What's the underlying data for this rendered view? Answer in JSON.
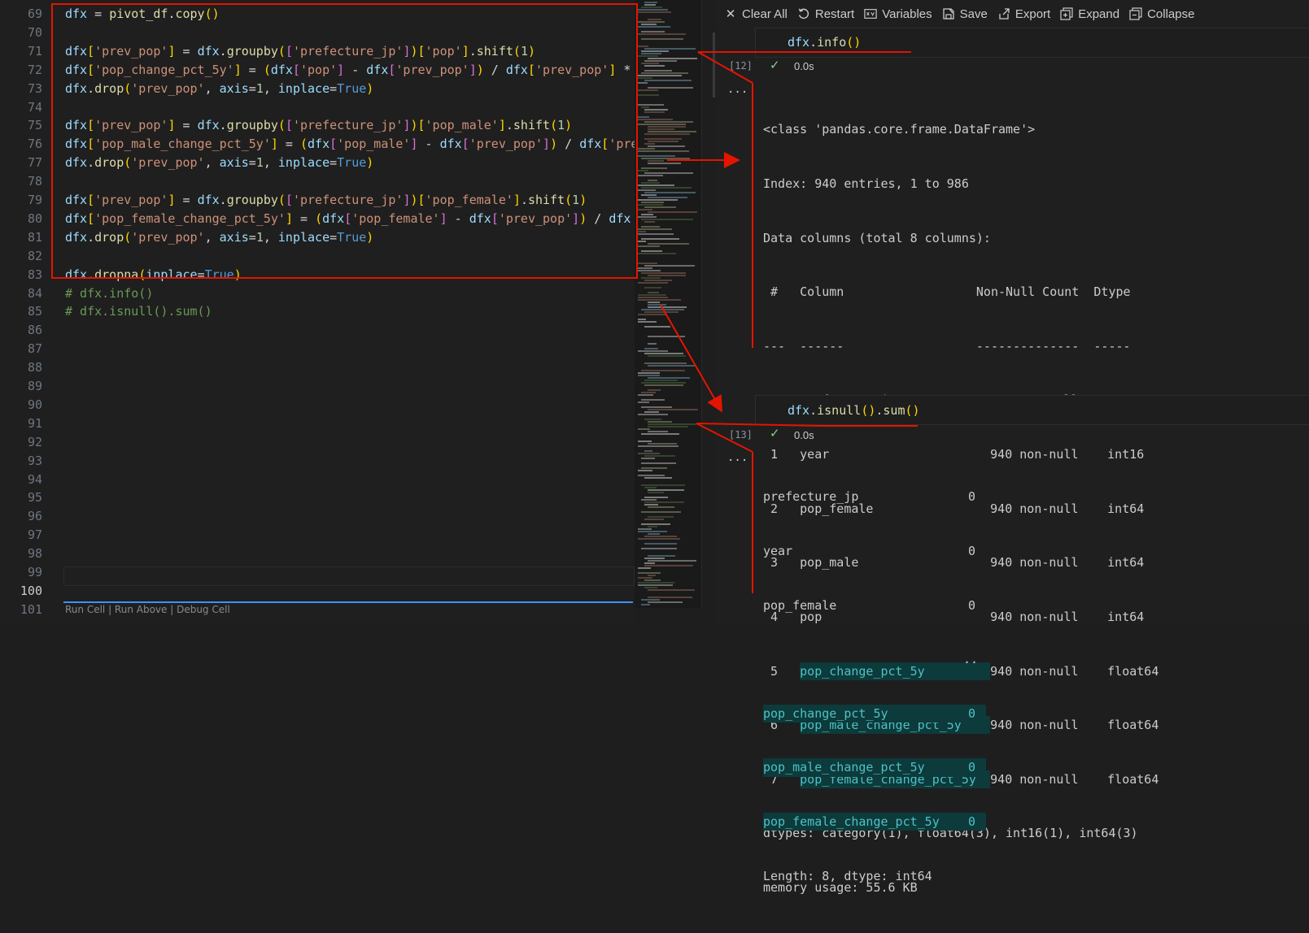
{
  "editor": {
    "line_numbers": [
      "69",
      "70",
      "71",
      "72",
      "73",
      "74",
      "75",
      "76",
      "77",
      "78",
      "79",
      "80",
      "81",
      "82",
      "83",
      "84",
      "85",
      "86",
      "87",
      "88",
      "89",
      "90",
      "91",
      "92",
      "93",
      "94",
      "95",
      "96",
      "97",
      "98",
      "99",
      "100",
      "101"
    ],
    "active_line": "100",
    "footer_text": "Run Cell | Run Above | Debug Cell"
  },
  "notebook": {
    "toolbar": {
      "clear_all": "Clear All",
      "restart": "Restart",
      "variables": "Variables",
      "save": "Save",
      "export": "Export",
      "expand": "Expand",
      "collapse": "Collapse"
    },
    "cell12": {
      "count": "[12]",
      "code": "dfx.info()",
      "time": "0.0s",
      "output": {
        "l1": "<class 'pandas.core.frame.DataFrame'>",
        "l2": "Index: 940 entries, 1 to 986",
        "l3": "Data columns (total 8 columns):",
        "header": " #   Column                  Non-Null Count  Dtype",
        "sep": "---  ------                  --------------  -----",
        "rows": [
          {
            "idx": " 0",
            "col": "prefecture_jp",
            "count": "940 non-null",
            "dtype": "category"
          },
          {
            "idx": " 1",
            "col": "year",
            "count": "940 non-null",
            "dtype": "int16"
          },
          {
            "idx": " 2",
            "col": "pop_female",
            "count": "940 non-null",
            "dtype": "int64"
          },
          {
            "idx": " 3",
            "col": "pop_male",
            "count": "940 non-null",
            "dtype": "int64"
          },
          {
            "idx": " 4",
            "col": "pop",
            "count": "940 non-null",
            "dtype": "int64"
          },
          {
            "idx": " 5",
            "col": "pop_change_pct_5y",
            "count": "940 non-null",
            "dtype": "float64"
          },
          {
            "idx": " 6",
            "col": "pop_male_change_pct_5y",
            "count": "940 non-null",
            "dtype": "float64"
          },
          {
            "idx": " 7",
            "col": "pop_female_change_pct_5y",
            "count": "940 non-null",
            "dtype": "float64"
          }
        ],
        "dtypes": "dtypes: category(1), float64(3), int16(1), int64(3)",
        "memory": "memory usage: 55.6 KB"
      }
    },
    "cell13": {
      "count": "[13]",
      "code": "dfx.isnull().sum()",
      "time": "0.0s",
      "output": {
        "rows": [
          {
            "name": "prefecture_jp",
            "val": "0"
          },
          {
            "name": "year",
            "val": "0"
          },
          {
            "name": "pop_female",
            "val": "0"
          }
        ],
        "ellipsis": "..",
        "rows_hl": [
          {
            "name": "pop_change_pct_5y",
            "val": "0"
          },
          {
            "name": "pop_male_change_pct_5y",
            "val": "0"
          },
          {
            "name": "pop_female_change_pct_5y",
            "val": "0"
          }
        ],
        "footer": "Length: 8, dtype: int64"
      }
    }
  },
  "colors": {
    "annotation": "#e51400",
    "highlight_bg": "#0d3a3a",
    "highlight_fg": "#4fc1c7"
  }
}
